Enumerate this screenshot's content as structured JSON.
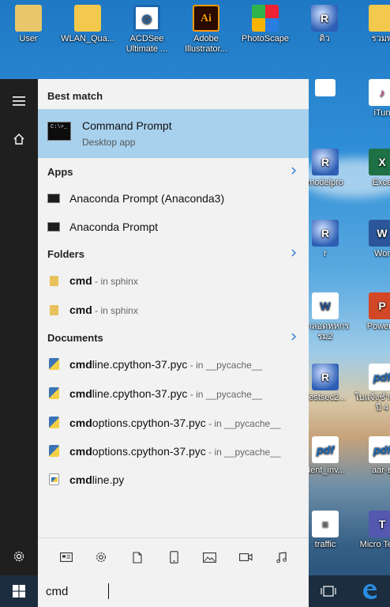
{
  "desktop": {
    "icons": [
      {
        "label": "User",
        "glyph": "",
        "kind": "user-icon"
      },
      {
        "label": "WLAN_Qua...",
        "glyph": "",
        "kind": "folder-icon"
      },
      {
        "label": "ACDSee Ultimate ...",
        "glyph": "◎",
        "kind": "acdsee-icon"
      },
      {
        "label": "Adobe Illustrator...",
        "glyph": "Ai",
        "kind": "illustrator-icon"
      },
      {
        "label": "PhotoScape",
        "glyph": "",
        "kind": "photoscape-icon"
      },
      {
        "label": "ติว",
        "glyph": "R",
        "kind": "r-icon"
      },
      {
        "label": "รวมพ",
        "glyph": "",
        "kind": "folder-icon"
      },
      {
        "label": "",
        "glyph": "",
        "kind": "document-icon"
      },
      {
        "label": "iTun",
        "glyph": "♪",
        "kind": "itunes-icon"
      },
      {
        "label": "modelpro",
        "glyph": "R",
        "kind": "r-icon"
      },
      {
        "label": "Exce",
        "glyph": "X",
        "kind": "excel-icon"
      },
      {
        "label": "r",
        "glyph": "R",
        "kind": "r-icon"
      },
      {
        "label": "Wor",
        "glyph": "W",
        "kind": "word-icon"
      },
      {
        "label": "กาลอดหหกรรม2",
        "glyph": "W",
        "kind": "word-doc-icon"
      },
      {
        "label": "PowerP",
        "glyph": "P",
        "kind": "powerpoint-icon"
      },
      {
        "label": "Testsec2...",
        "glyph": "R",
        "kind": "r-icon"
      },
      {
        "label": "ใบแจ้งชำเทอม ปี 4",
        "glyph": "pdf",
        "kind": "pdf-icon"
      },
      {
        "label": "dent_inv...",
        "glyph": "pdf",
        "kind": "pdf-icon"
      },
      {
        "label": "aar-ยุ",
        "glyph": "pdf",
        "kind": "pdf-icon"
      },
      {
        "label": "traffic",
        "glyph": "≡",
        "kind": "text-file-icon"
      },
      {
        "label": "Micro Team",
        "glyph": "T",
        "kind": "teams-icon"
      }
    ]
  },
  "start_menu": {
    "best_match": {
      "heading": "Best match",
      "title": "Command Prompt",
      "subtitle": "Desktop app",
      "icon_text": "C:\\>_"
    },
    "apps": {
      "heading": "Apps",
      "items": [
        {
          "label": "Anaconda Prompt (Anaconda3)"
        },
        {
          "label": "Anaconda Prompt"
        }
      ]
    },
    "folders": {
      "heading": "Folders",
      "items": [
        {
          "match": "cmd",
          "rest": "",
          "detail": " - in sphinx"
        },
        {
          "match": "cmd",
          "rest": "",
          "detail": " - in sphinx"
        }
      ]
    },
    "documents": {
      "heading": "Documents",
      "items": [
        {
          "match": "cmd",
          "rest": "line.cpython-37.pyc",
          "detail": " - in __pycache__"
        },
        {
          "match": "cmd",
          "rest": "line.cpython-37.pyc",
          "detail": " - in __pycache__"
        },
        {
          "match": "cmd",
          "rest": "options.cpython-37.pyc",
          "detail": " - in __pycache__"
        },
        {
          "match": "cmd",
          "rest": "options.cpython-37.pyc",
          "detail": " - in __pycache__"
        },
        {
          "match": "cmd",
          "rest": "line.py",
          "detail": ""
        }
      ]
    },
    "filters": [
      "apps-filter-icon",
      "settings-filter-icon",
      "documents-filter-icon",
      "phone-filter-icon",
      "photos-filter-icon",
      "videos-filter-icon",
      "music-filter-icon"
    ]
  },
  "taskbar": {
    "search_value": "cmd"
  },
  "colors": {
    "highlight": "#a8d1ee",
    "rail": "#1f1f1f",
    "panel": "#f2f2f2",
    "accent": "#2b7bd4"
  }
}
